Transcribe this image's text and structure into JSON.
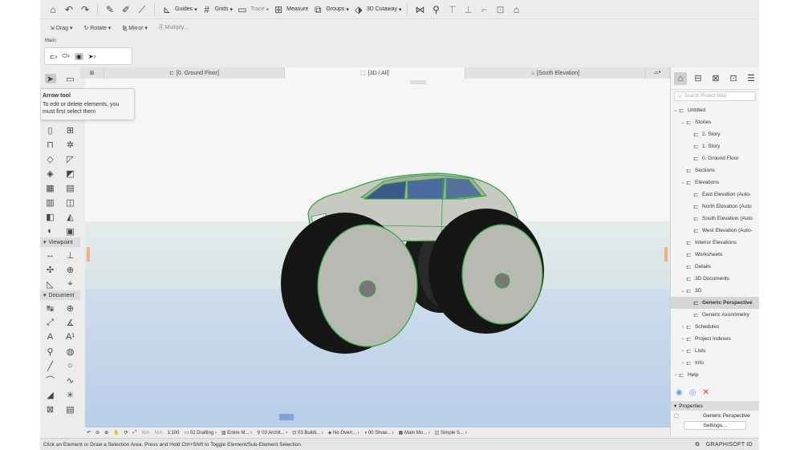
{
  "toolbar": {
    "guides": "Guides",
    "grids": "Grids",
    "trace": "Trace",
    "measure": "Measure",
    "groups": "Groups",
    "cutaway": "3D Cutaway"
  },
  "edit_toolbar": {
    "drag": "Drag",
    "rotate": "Rotate",
    "mirror": "Mirror",
    "multiply": "Multiply..."
  },
  "info_box": {
    "label": "Main:"
  },
  "tabs": [
    {
      "label": "[0. Ground Floor]"
    },
    {
      "label": "[3D / All]"
    },
    {
      "label": "[South Elevation]"
    }
  ],
  "tooltip": {
    "title": "Arrow tool",
    "text": "To edit or delete elements, you must first select them"
  },
  "toolbox": {
    "viewpoint_label": "Viewpoint",
    "document_label": "Document"
  },
  "navigator": {
    "search_placeholder": "Search Project Map",
    "tree": [
      {
        "label": "Untitled",
        "level": 0,
        "chev": "v"
      },
      {
        "label": "Stories",
        "level": 1,
        "chev": "v"
      },
      {
        "label": "2. Story",
        "level": 2,
        "chev": ""
      },
      {
        "label": "1. Story",
        "level": 2,
        "chev": ""
      },
      {
        "label": "0. Ground Floor",
        "level": 2,
        "chev": ""
      },
      {
        "label": "Sections",
        "level": 1,
        "chev": ""
      },
      {
        "label": "Elevations",
        "level": 1,
        "chev": "v"
      },
      {
        "label": "East Elevation (Auto-",
        "level": 2,
        "chev": ""
      },
      {
        "label": "North Elevation (Auto",
        "level": 2,
        "chev": ""
      },
      {
        "label": "South Elevation (Auto",
        "level": 2,
        "chev": ""
      },
      {
        "label": "West Elevation (Auto-",
        "level": 2,
        "chev": ""
      },
      {
        "label": "Interior Elevations",
        "level": 1,
        "chev": ""
      },
      {
        "label": "Worksheets",
        "level": 1,
        "chev": ""
      },
      {
        "label": "Details",
        "level": 1,
        "chev": ""
      },
      {
        "label": "3D Documents",
        "level": 1,
        "chev": ""
      },
      {
        "label": "3D",
        "level": 1,
        "chev": "v"
      },
      {
        "label": "Generic Perspective",
        "level": 2,
        "chev": "",
        "selected": true
      },
      {
        "label": "Generic Axonometry",
        "level": 2,
        "chev": ""
      },
      {
        "label": "Schedules",
        "level": 1,
        "chev": ">"
      },
      {
        "label": "Project Indexes",
        "level": 1,
        "chev": ">"
      },
      {
        "label": "Lists",
        "level": 1,
        "chev": ">"
      },
      {
        "label": "Info",
        "level": 1,
        "chev": ">"
      },
      {
        "label": "Help",
        "level": 0,
        "chev": ">"
      }
    ]
  },
  "properties": {
    "header": "Properties",
    "value": "Generic Perspective",
    "settings": "Settings..."
  },
  "status": {
    "na1": "N/A",
    "na2": "N/A",
    "scale": "1:100",
    "layer": "02 Drafting",
    "entire": "Entire M...",
    "arch": "03 Archit...",
    "build": "03 Buildi...",
    "override": "No Overr...",
    "show": "00 Show...",
    "model": "Main Mo...",
    "simple": "Simple S..."
  },
  "message": "Click an Element or Draw a Selection Area. Press and Hold Ctrl+Shift to Toggle Element/Sub-Element Selection.",
  "brand": "GRAPHISOFT ID",
  "colors": {
    "accent": "#f0b08a",
    "selection": "#2fa83a",
    "ground": "#c2d4ea"
  }
}
